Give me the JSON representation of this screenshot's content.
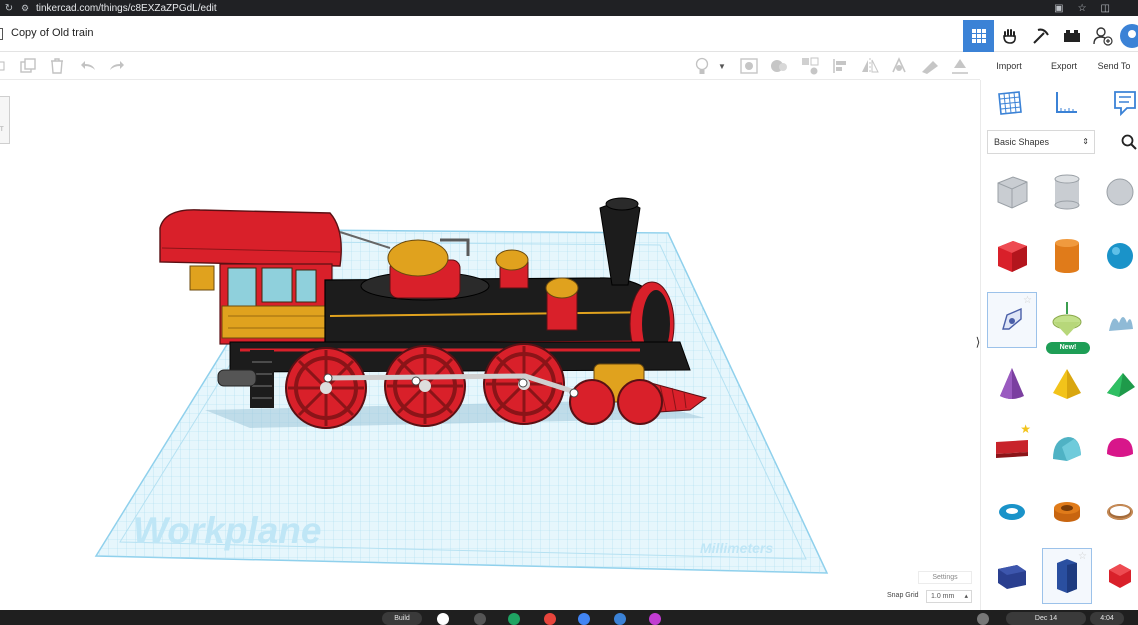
{
  "browser": {
    "url": "tinkercad.com/things/c8EXZaZPGdL/edit",
    "reload_icon": "reload-icon",
    "site_info_icon": "site-info-icon"
  },
  "header": {
    "title": "Copy of Old train",
    "icons": [
      "grid-view-icon",
      "tinker-hand-icon",
      "pickaxe-icon",
      "blocks-icon",
      "add-user-icon"
    ]
  },
  "toolbar": {
    "import_label": "Import",
    "export_label": "Export",
    "send_to_label": "Send To",
    "tools": [
      "copy-icon",
      "paste-icon",
      "delete-icon",
      "undo-icon",
      "redo-icon",
      "light-bulb-icon",
      "dropdown-icon",
      "group-icon",
      "ungroup-icon",
      "hole-icon",
      "align-icon",
      "mirror-icon",
      "cruise-icon",
      "ruler-icon",
      "workplane-icon"
    ]
  },
  "canvas": {
    "workplane_label": "Workplane",
    "units_label": "Millimeters",
    "settings_label": "Settings",
    "snap_grid_label": "Snap Grid",
    "snap_grid_value": "1.0 mm",
    "viewcube_label": "T",
    "model": "steam-locomotive"
  },
  "panel": {
    "view_icons": [
      "grid-view-icon",
      "ruler-icon",
      "notes-icon"
    ],
    "category": "Basic Shapes",
    "new_badge": "New!",
    "shapes": [
      {
        "name": "box-hole-shape"
      },
      {
        "name": "cylinder-hole-shape"
      },
      {
        "name": "sphere-hole-shape"
      },
      {
        "name": "box-shape",
        "color": "#d9202a"
      },
      {
        "name": "cylinder-shape",
        "color": "#e07b1a"
      },
      {
        "name": "sphere-shape",
        "color": "#1a93c9"
      },
      {
        "name": "scribble-shape"
      },
      {
        "name": "spinner-shape"
      },
      {
        "name": "shape-generator-shape"
      },
      {
        "name": "cone-shape",
        "color": "#7b3fa0"
      },
      {
        "name": "pyramid-shape",
        "color": "#f2c31a"
      },
      {
        "name": "wedge-shape",
        "color": "#1f9a4a"
      },
      {
        "name": "text-shape",
        "color": "#c8232b"
      },
      {
        "name": "half-cylinder-shape",
        "color": "#4fb2c4"
      },
      {
        "name": "half-sphere-shape",
        "color": "#d8168a"
      },
      {
        "name": "torus-shape",
        "color": "#1a93c9"
      },
      {
        "name": "tube-shape",
        "color": "#e07b1a"
      },
      {
        "name": "ring-shape",
        "color": "#a36b3b"
      },
      {
        "name": "polygon-shape",
        "color": "#2a3f8f"
      },
      {
        "name": "hexagonal-prism-shape",
        "color": "#2a4fa0"
      },
      {
        "name": "icosahedron-shape",
        "color": "#d9202a"
      }
    ]
  },
  "taskbar": {
    "items": [
      "Build",
      "Dec 14",
      "4:04"
    ]
  },
  "colors": {
    "accent": "#3b82d6",
    "workplane_grid": "#8fd0ec",
    "train_red": "#d9202a",
    "train_black": "#1c1c1c",
    "train_gold": "#e0a21e"
  }
}
